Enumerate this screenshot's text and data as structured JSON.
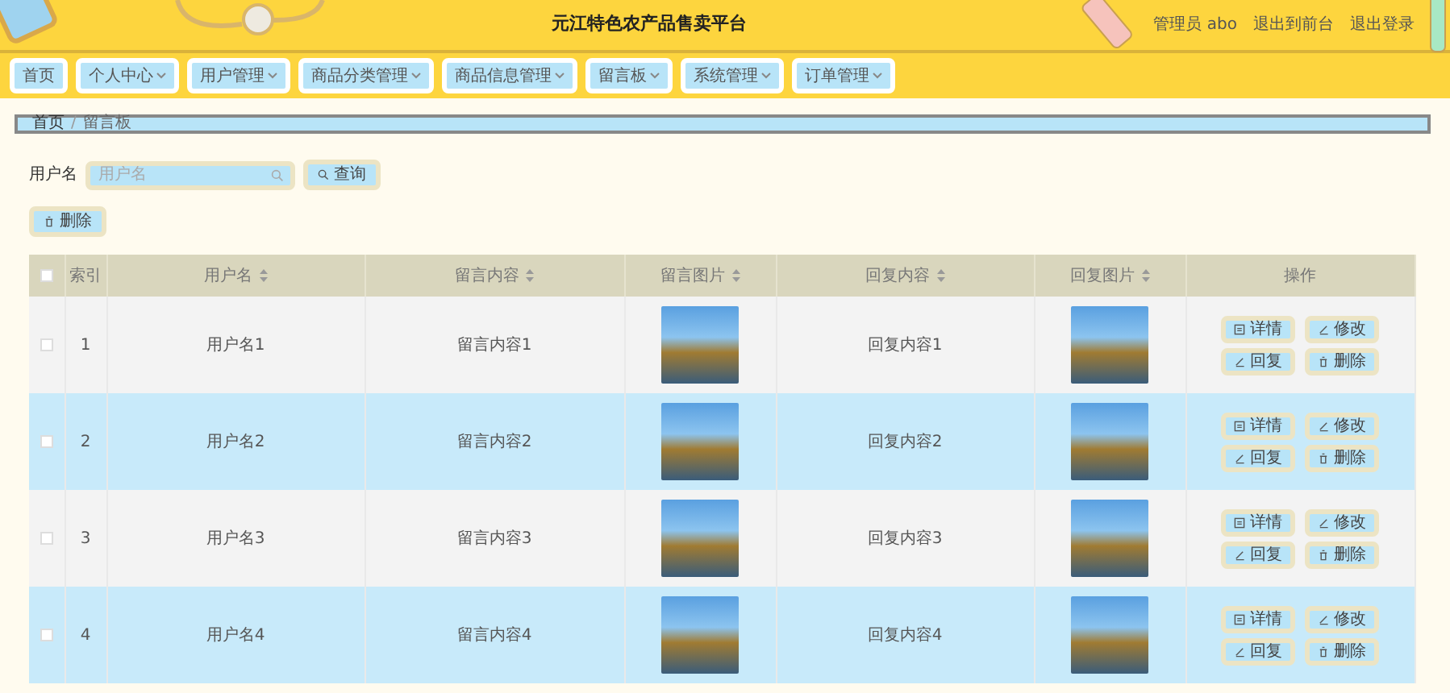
{
  "header": {
    "title": "元江特色农产品售卖平台",
    "links": [
      "管理员 abo",
      "退出到前台",
      "退出登录"
    ]
  },
  "nav": [
    {
      "label": "首页",
      "dropdown": false
    },
    {
      "label": "个人中心",
      "dropdown": true
    },
    {
      "label": "用户管理",
      "dropdown": true
    },
    {
      "label": "商品分类管理",
      "dropdown": true
    },
    {
      "label": "商品信息管理",
      "dropdown": true
    },
    {
      "label": "留言板",
      "dropdown": true
    },
    {
      "label": "系统管理",
      "dropdown": true
    },
    {
      "label": "订单管理",
      "dropdown": true
    }
  ],
  "breadcrumb": [
    "首页",
    "留言板"
  ],
  "breadcrumb_separator": "/",
  "select_all_checked": false,
  "search": {
    "label": "用户名",
    "placeholder": "用户名",
    "button": "查询"
  },
  "delete_button": "删除",
  "table": {
    "columns": [
      {
        "label": "索引",
        "sortable": false
      },
      {
        "label": "用户名",
        "sortable": true
      },
      {
        "label": "留言内容",
        "sortable": true
      },
      {
        "label": "留言图片",
        "sortable": true
      },
      {
        "label": "回复内容",
        "sortable": true
      },
      {
        "label": "回复图片",
        "sortable": true
      },
      {
        "label": "操作",
        "sortable": false
      }
    ],
    "rows": [
      {
        "checked": false,
        "index": "1",
        "username": "用户名1",
        "content": "留言内容1",
        "reply": "回复内容1",
        "actions": [
          {
            "kind": "detail",
            "label": "详情"
          },
          {
            "kind": "edit",
            "label": "修改"
          },
          {
            "kind": "edit",
            "label": "回复"
          },
          {
            "kind": "delete",
            "label": "删除"
          }
        ]
      },
      {
        "checked": false,
        "index": "2",
        "username": "用户名2",
        "content": "留言内容2",
        "reply": "回复内容2",
        "actions": [
          {
            "kind": "detail",
            "label": "详情"
          },
          {
            "kind": "edit",
            "label": "修改"
          },
          {
            "kind": "edit",
            "label": "回复"
          },
          {
            "kind": "delete",
            "label": "删除"
          }
        ]
      },
      {
        "checked": false,
        "index": "3",
        "username": "用户名3",
        "content": "留言内容3",
        "reply": "回复内容3",
        "actions": [
          {
            "kind": "detail",
            "label": "详情"
          },
          {
            "kind": "edit",
            "label": "修改"
          },
          {
            "kind": "edit",
            "label": "回复"
          },
          {
            "kind": "delete",
            "label": "删除"
          }
        ]
      },
      {
        "checked": false,
        "index": "4",
        "username": "用户名4",
        "content": "留言内容4",
        "reply": "回复内容4",
        "actions": [
          {
            "kind": "detail",
            "label": "详情"
          },
          {
            "kind": "edit",
            "label": "修改"
          },
          {
            "kind": "edit",
            "label": "回复"
          },
          {
            "kind": "delete",
            "label": "删除"
          }
        ]
      }
    ]
  }
}
